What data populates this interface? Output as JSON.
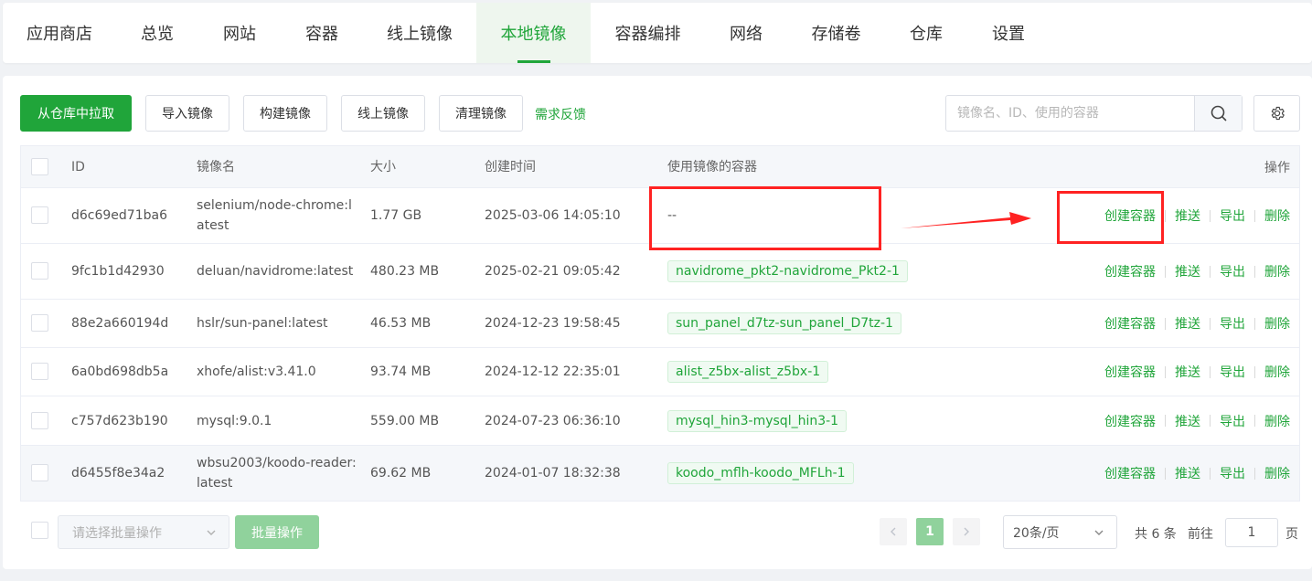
{
  "nav": {
    "tabs": [
      "应用商店",
      "总览",
      "网站",
      "容器",
      "线上镜像",
      "本地镜像",
      "容器编排",
      "网络",
      "存储卷",
      "仓库",
      "设置"
    ],
    "active_index": 5
  },
  "toolbar": {
    "pull": "从仓库中拉取",
    "import": "导入镜像",
    "build": "构建镜像",
    "online": "线上镜像",
    "clean": "清理镜像",
    "feedback": "需求反馈",
    "search_placeholder": "镜像名、ID、使用的容器"
  },
  "table": {
    "headers": {
      "id": "ID",
      "name": "镜像名",
      "size": "大小",
      "created": "创建时间",
      "containers": "使用镜像的容器",
      "ops": "操作"
    },
    "ops": {
      "create": "创建容器",
      "push": "推送",
      "export": "导出",
      "delete": "删除"
    },
    "rows": [
      {
        "id": "d6c69ed71ba6",
        "name": "selenium/node-chrome:latest",
        "size": "1.77 GB",
        "created": "2025-03-06 14:05:10",
        "container": "--"
      },
      {
        "id": "9fc1b1d42930",
        "name": "deluan/navidrome:latest",
        "size": "480.23 MB",
        "created": "2025-02-21 09:05:42",
        "container": "navidrome_pkt2-navidrome_Pkt2-1"
      },
      {
        "id": "88e2a660194d",
        "name": "hslr/sun-panel:latest",
        "size": "46.53 MB",
        "created": "2024-12-23 19:58:45",
        "container": "sun_panel_d7tz-sun_panel_D7tz-1"
      },
      {
        "id": "6a0bd698db5a",
        "name": "xhofe/alist:v3.41.0",
        "size": "93.74 MB",
        "created": "2024-12-12 22:35:01",
        "container": "alist_z5bx-alist_z5bx-1"
      },
      {
        "id": "c757d623b190",
        "name": "mysql:9.0.1",
        "size": "559.00 MB",
        "created": "2024-07-23 06:36:10",
        "container": "mysql_hin3-mysql_hin3-1"
      },
      {
        "id": "d6455f8e34a2",
        "name": "wbsu2003/koodo-reader:latest",
        "size": "69.62 MB",
        "created": "2024-01-07 18:32:38",
        "container": "koodo_mflh-koodo_MFLh-1"
      }
    ]
  },
  "footer": {
    "batch_placeholder": "请选择批量操作",
    "batch_button": "批量操作",
    "current_page": "1",
    "page_size": "20条/页",
    "total": "共 6 条",
    "goto_label": "前往",
    "goto_value": "1",
    "page_unit": "页"
  },
  "colors": {
    "accent": "#20a53a",
    "annotation": "#ff2222"
  }
}
